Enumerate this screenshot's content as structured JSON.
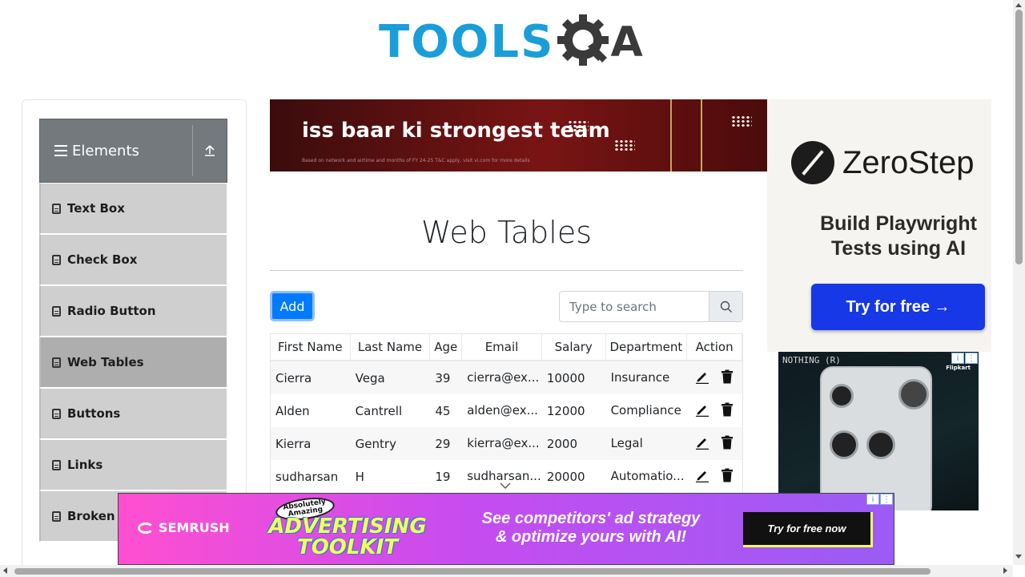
{
  "header": {
    "logo_text": "TOOLS",
    "logo_suffix": "A"
  },
  "sidebar": {
    "group_title": "Elements",
    "items": [
      {
        "label": "Text Box"
      },
      {
        "label": "Check Box"
      },
      {
        "label": "Radio Button"
      },
      {
        "label": "Web Tables"
      },
      {
        "label": "Buttons"
      },
      {
        "label": "Links"
      },
      {
        "label": "Broken L"
      }
    ],
    "active_index": 3
  },
  "top_ad": {
    "headline": "iss baar ki strongest team",
    "fine_print": "Based on network and airtime and months of FY 24-25 T&C apply, visit vi.com for more details"
  },
  "main": {
    "title": "Web Tables",
    "add_label": "Add",
    "search_placeholder": "Type to search"
  },
  "table": {
    "headers": [
      "First Name",
      "Last Name",
      "Age",
      "Email",
      "Salary",
      "Department",
      "Action"
    ],
    "rows": [
      [
        "Cierra",
        "Vega",
        "39",
        "cierra@example.com",
        "10000",
        "Insurance"
      ],
      [
        "Alden",
        "Cantrell",
        "45",
        "alden@example.com",
        "12000",
        "Compliance"
      ],
      [
        "Kierra",
        "Gentry",
        "29",
        "kierra@example.com",
        "2000",
        "Legal"
      ],
      [
        "sudharsan",
        "H",
        "19",
        "sudharsan@example.com",
        "20000",
        "Automation"
      ]
    ],
    "display_rows": [
      [
        "Cierra",
        "Vega",
        "39",
        "cierra@ex...",
        "10000",
        "Insurance"
      ],
      [
        "Alden",
        "Cantrell",
        "45",
        "alden@ex...",
        "12000",
        "Compliance"
      ],
      [
        "Kierra",
        "Gentry",
        "29",
        "kierra@ex...",
        "2000",
        "Legal"
      ],
      [
        "sudharsan",
        "H",
        "19",
        "sudharsan...",
        "20000",
        "Automatio..."
      ]
    ]
  },
  "right_ad": {
    "brand": "ZeroStep",
    "tagline_line1": "Build Playwright",
    "tagline_line2": "Tests using AI",
    "cta": "Try for free →"
  },
  "phone_ad": {
    "brand": "NOTHING (R)",
    "retailer": "Flipkart"
  },
  "bottom_ad": {
    "brand": "SEMRUSH",
    "badge_line1": "Absolutely",
    "badge_line2": "Amazing",
    "title_line1": "ADVERTISING",
    "title_line2": "TOOLKIT",
    "copy_line1": "See competitors' ad strategy",
    "copy_line2": "& optimize yours with AI!",
    "cta": "Try for free now"
  },
  "colors": {
    "brand_blue": "#1a9ed9",
    "primary": "#007bff",
    "sidebar_header": "#74797e",
    "active_item": "#aeaeae"
  }
}
